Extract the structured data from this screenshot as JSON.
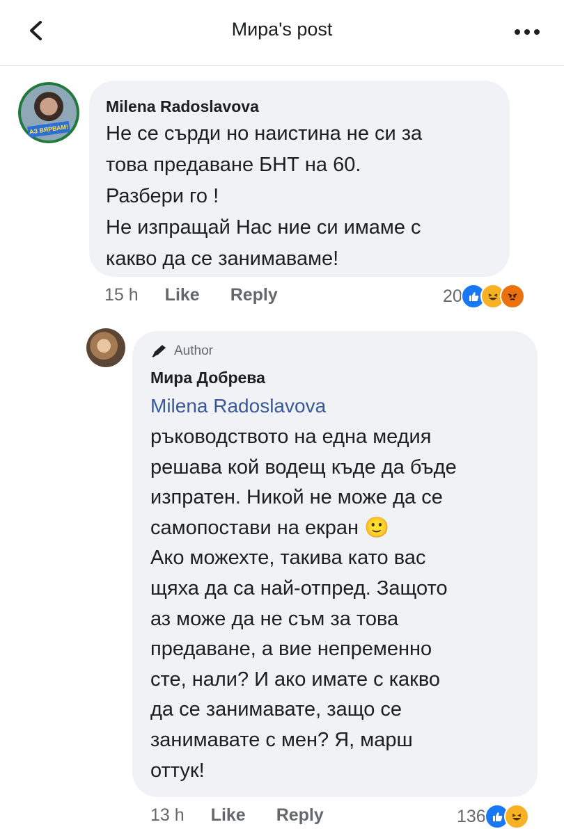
{
  "header": {
    "title": "Мира's post"
  },
  "comments": [
    {
      "author": "Milena Radoslavova",
      "avatar_badge": "АЗ ВЯРВАМ!",
      "text": "Не се сърди но наистина не си за\nтова предаване  БНТ на 60.\nРазбери го !\nНе изпращай Нас ние си имаме с\nкакво да се занимаваме!",
      "time": "15 h",
      "like_label": "Like",
      "reply_label": "Reply",
      "reaction_count": "20",
      "reactions": [
        "like-icon",
        "haha-icon",
        "angry-icon"
      ]
    },
    {
      "author_badge": "Author",
      "author": "Мира Добрева",
      "mention": "Milena Radoslavova",
      "text": "ръководството на една медия\nрешава кой водещ къде да бъде\nизпратен. Никой не може да се\nсамопостави на екран 🙂\nАко можехте, такива като вас\nщяха да са най-отпред. Защото\nаз може да не съм за това\nпредаване, а вие непременно\nсте, нали? И ако имате с какво\nда се занимавате, защо се\nзанимавате с мен? Я, марш\nоттук!",
      "time": "13 h",
      "like_label": "Like",
      "reply_label": "Reply",
      "reaction_count": "136",
      "reactions": [
        "like-icon",
        "haha-icon"
      ]
    }
  ],
  "colors": {
    "bubble": "#f0f2f5",
    "mention": "#385898",
    "like": "#1877f2",
    "haha": "#f7b125",
    "angry": "#e9710f"
  }
}
